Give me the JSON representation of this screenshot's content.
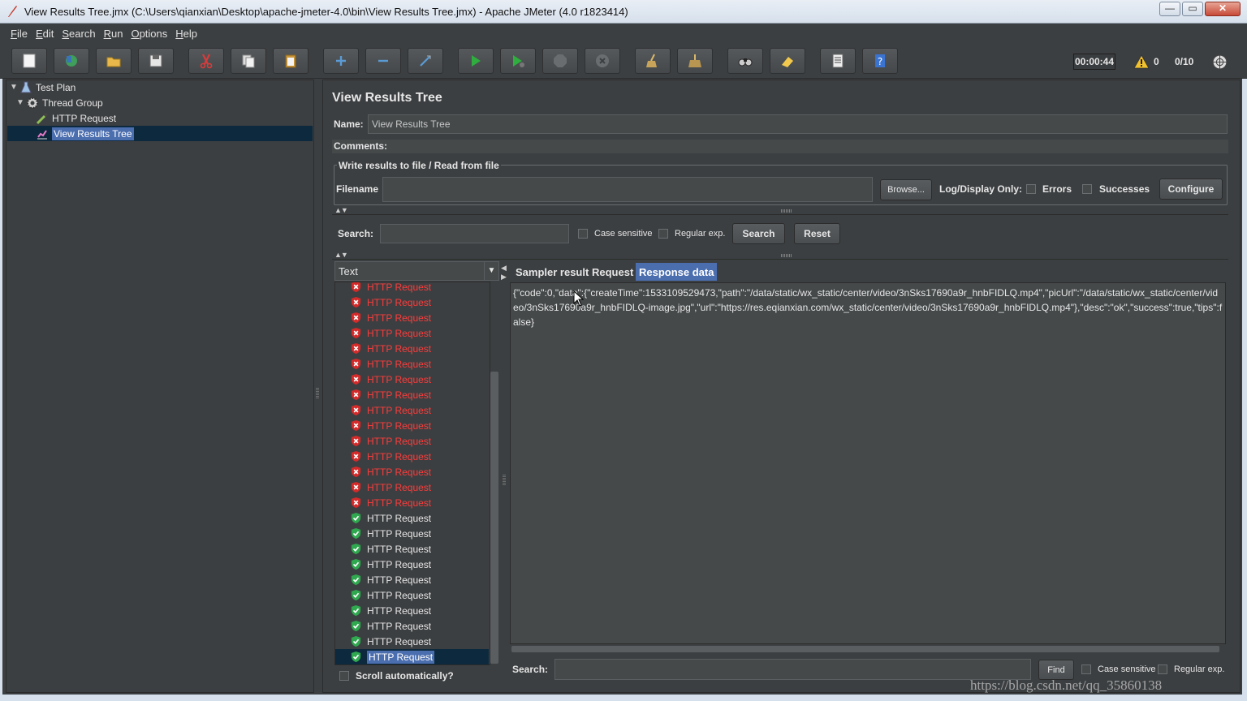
{
  "window": {
    "title": "View Results Tree.jmx (C:\\Users\\qianxian\\Desktop\\apache-jmeter-4.0\\bin\\View Results Tree.jmx) - Apache JMeter (4.0 r1823414)",
    "minimize": "—",
    "maximize": "▭",
    "close": "✕"
  },
  "menu": [
    "File",
    "Edit",
    "Search",
    "Run",
    "Options",
    "Help"
  ],
  "toolbar": {
    "timer": "00:00:44",
    "error_count": "0",
    "thread_count": "0/10"
  },
  "tree": {
    "nodes": [
      {
        "label": "Test Plan",
        "icon": "flask-icon"
      },
      {
        "label": "Thread Group",
        "icon": "gear-icon"
      },
      {
        "label": "HTTP Request",
        "icon": "pipette-icon"
      },
      {
        "label": "View Results Tree",
        "icon": "chart-icon",
        "selected": true
      }
    ]
  },
  "panel": {
    "title": "View Results Tree",
    "name_label": "Name:",
    "name_value": "View Results Tree",
    "comments_label": "Comments:",
    "write_group_title": "Write results to file / Read from file",
    "filename_label": "Filename",
    "filename_value": "",
    "browse_label": "Browse...",
    "log_display_label": "Log/Display Only:",
    "errors_label": "Errors",
    "successes_label": "Successes",
    "configure_label": "Configure"
  },
  "search": {
    "label": "Search:",
    "value": "",
    "case_sensitive_label": "Case sensitive",
    "regex_label": "Regular exp.",
    "search_button": "Search",
    "reset_button": "Reset"
  },
  "renderer": {
    "selected": "Text"
  },
  "results": {
    "item_label": "HTTP Request",
    "failed_count_visible": 15,
    "passed_count_visible": 10,
    "scroll_auto_label": "Scroll automatically?"
  },
  "tabs": [
    "Sampler result",
    "Request",
    "Response data"
  ],
  "active_tab": "Response data",
  "response": {
    "text": "{\"code\":0,\"data\":{\"createTime\":1533109529473,\"path\":\"/data/static/wx_static/center/video/3nSks17690a9r_hnbFIDLQ.mp4\",\"picUrl\":\"/data/static/wx_static/center/video/3nSks17690a9r_hnbFIDLQ-image.jpg\",\"url\":\"https://res.eqianxian.com/wx_static/center/video/3nSks17690a9r_hnbFIDLQ.mp4\"},\"desc\":\"ok\",\"success\":true,\"tips\":false}"
  },
  "bottom_search": {
    "label": "Search:",
    "value": "",
    "find_button": "Find",
    "case_sensitive_label": "Case sensitive",
    "regex_label": "Regular exp."
  },
  "watermark": "https://blog.csdn.net/qq_35860138",
  "colors": {
    "background": "#3c3f41",
    "selection": "#4b6eaf",
    "error_text": "#ff3b3b",
    "ok_icon": "#2fa84f",
    "fail_icon": "#d42a2a"
  }
}
